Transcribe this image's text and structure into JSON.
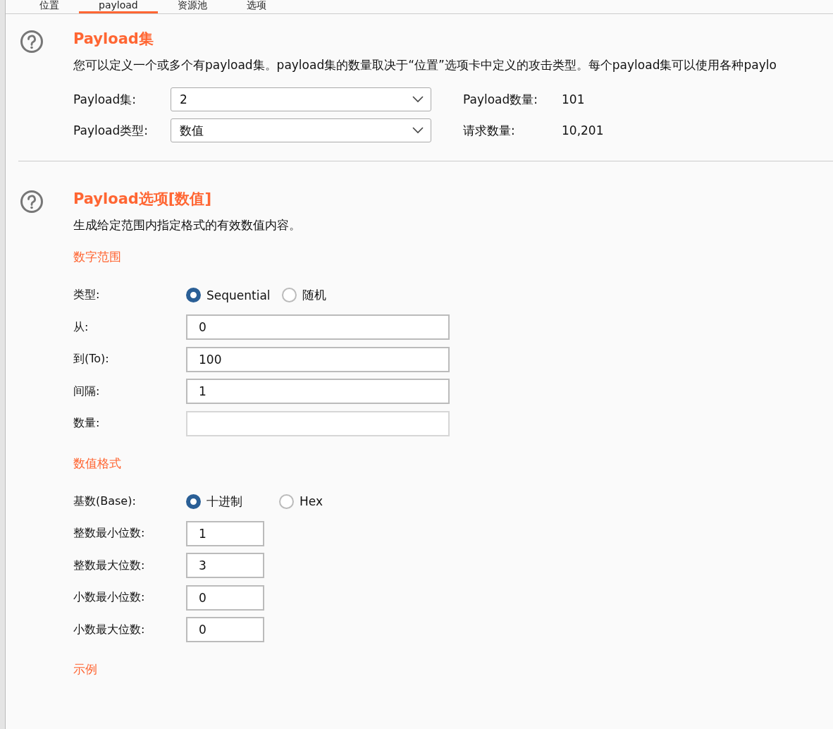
{
  "tabs": [
    {
      "label": "位置",
      "selected": false
    },
    {
      "label": "payload",
      "selected": true
    },
    {
      "label": "资源池",
      "selected": false
    },
    {
      "label": "选项",
      "selected": false
    }
  ],
  "payload_sets": {
    "title": "Payload集",
    "description": "您可以定义一个或多个有payload集。payload集的数量取决于“位置”选项卡中定义的攻击类型。每个payload集可以使用各种paylo",
    "fields": [
      {
        "label": "Payload集:",
        "value": "2",
        "info_label": "Payload数量:",
        "info_value": "101"
      },
      {
        "label": "Payload类型:",
        "value": "数值",
        "info_label": "请求数量:",
        "info_value": "10,201"
      }
    ]
  },
  "payload_options": {
    "title": "Payload选项[数值]",
    "description": "生成给定范围内指定格式的有效数值内容。",
    "groups": [
      {
        "heading": "数字范围",
        "rows": [
          {
            "kind": "radio",
            "label": "类型:",
            "options": [
              {
                "label": "Sequential",
                "selected": true
              },
              {
                "label": "随机",
                "selected": false
              }
            ]
          },
          {
            "kind": "input",
            "label": "从:",
            "value": "0",
            "disabled": false
          },
          {
            "kind": "input",
            "label": "到(To):",
            "value": "100",
            "disabled": false
          },
          {
            "kind": "input",
            "label": "间隔:",
            "value": "1",
            "disabled": false
          },
          {
            "kind": "input",
            "label": "数量:",
            "disabled": true
          }
        ]
      },
      {
        "heading": "数值格式",
        "rows": [
          {
            "kind": "radio",
            "label": "基数(Base):",
            "options": [
              {
                "label": "十进制",
                "selected": true
              },
              {
                "label": "Hex",
                "selected": false
              }
            ]
          },
          {
            "kind": "short_input",
            "label": "整数最小位数:",
            "value": "1",
            "disabled": false
          },
          {
            "kind": "short_input",
            "label": "整数最大位数:",
            "value": "3",
            "disabled": false
          },
          {
            "kind": "short_input",
            "label": "小数最小位数:",
            "value": "0",
            "disabled": false
          },
          {
            "kind": "short_input",
            "label": "小数最大位数:",
            "value": "0",
            "disabled": false
          }
        ]
      },
      {
        "heading": "示例"
      }
    ]
  }
}
